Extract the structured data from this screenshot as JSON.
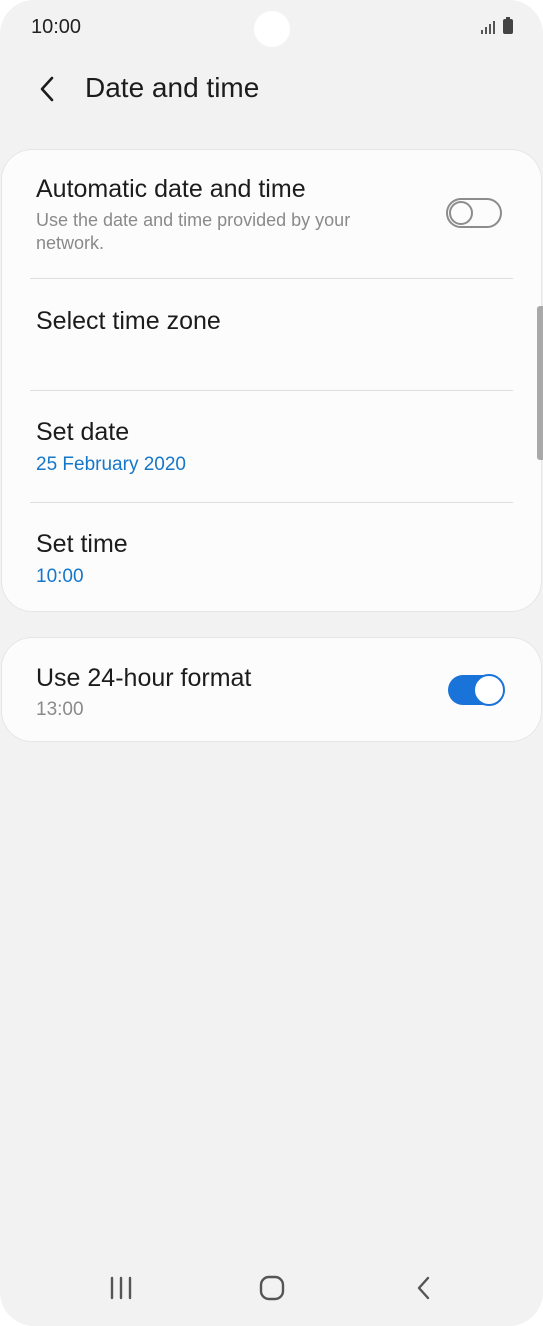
{
  "status_bar": {
    "time": "10:00"
  },
  "header": {
    "title": "Date and time",
    "back_icon": "chevron-left-icon"
  },
  "settings": {
    "auto_date_time": {
      "title": "Automatic date and time",
      "subtitle": "Use the date and time provided by your network.",
      "enabled": false
    },
    "time_zone": {
      "title": "Select time zone"
    },
    "set_date": {
      "title": "Set date",
      "value": "25 February 2020"
    },
    "set_time": {
      "title": "Set time",
      "value": "10:00"
    },
    "hour_format": {
      "title": "Use 24-hour format",
      "value": "13:00",
      "enabled": true
    }
  },
  "nav_bar": {
    "recents_icon": "recent-apps-icon",
    "home_icon": "home-icon",
    "back_icon": "back-icon"
  },
  "colors": {
    "accent": "#1a73d9",
    "value_text": "#1677c9",
    "background": "#f2f2f2",
    "card": "#fcfcfc"
  }
}
